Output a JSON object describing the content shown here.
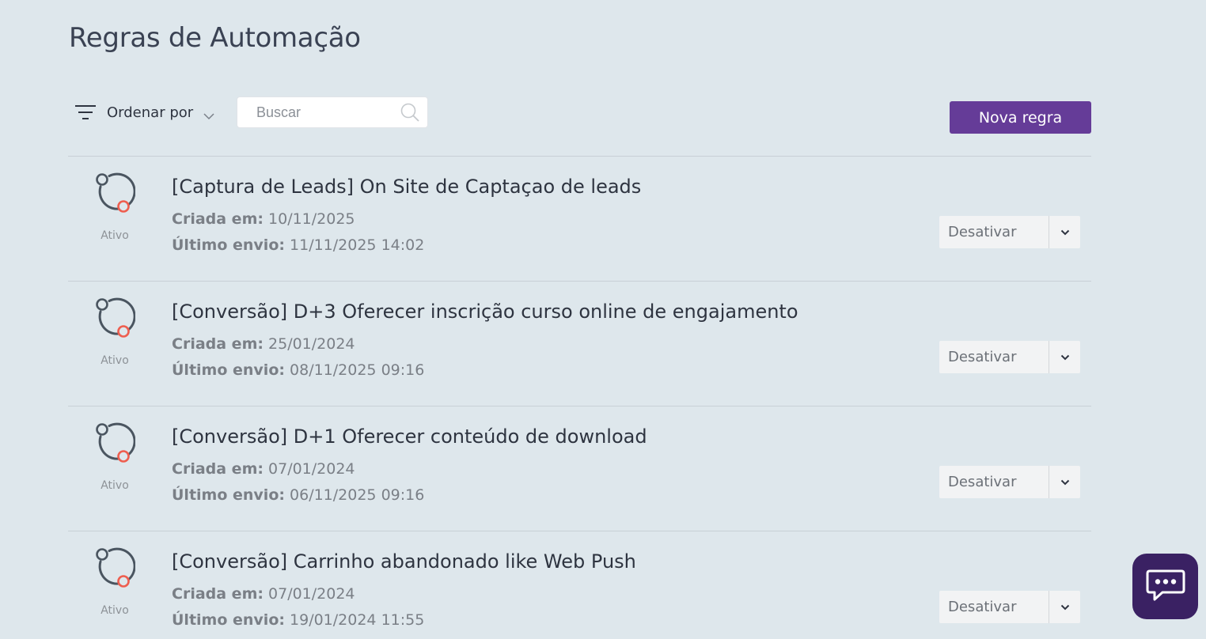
{
  "page": {
    "title": "Regras de Automação"
  },
  "toolbar": {
    "sort_label": "Ordenar por",
    "search_placeholder": "Buscar",
    "search_value": "",
    "new_rule_label": "Nova regra"
  },
  "colors": {
    "primary": "#653c98",
    "status_dot": "#ee5e4f",
    "chat_bg": "#3a2163"
  },
  "rules": [
    {
      "title": "[Captura de Leads] On Site de Captaçao de leads",
      "status": "Ativo",
      "created_label": "Criada em:",
      "created": "10/11/2025",
      "last_send_label": "Último envio:",
      "last_send": "11/11/2025 14:02",
      "action_label": "Desativar"
    },
    {
      "title": "[Conversão] D+3 Oferecer inscrição curso online de engajamento",
      "status": "Ativo",
      "created_label": "Criada em:",
      "created": "25/01/2024",
      "last_send_label": "Último envio:",
      "last_send": "08/11/2025 09:16",
      "action_label": "Desativar"
    },
    {
      "title": "[Conversão] D+1 Oferecer conteúdo de download",
      "status": "Ativo",
      "created_label": "Criada em:",
      "created": "07/01/2024",
      "last_send_label": "Último envio:",
      "last_send": "06/11/2025 09:16",
      "action_label": "Desativar"
    },
    {
      "title": "[Conversão] Carrinho abandonado like Web Push",
      "status": "Ativo",
      "created_label": "Criada em:",
      "created": "07/01/2024",
      "last_send_label": "Último envio:",
      "last_send": "19/01/2024 11:55",
      "action_label": "Desativar"
    }
  ]
}
